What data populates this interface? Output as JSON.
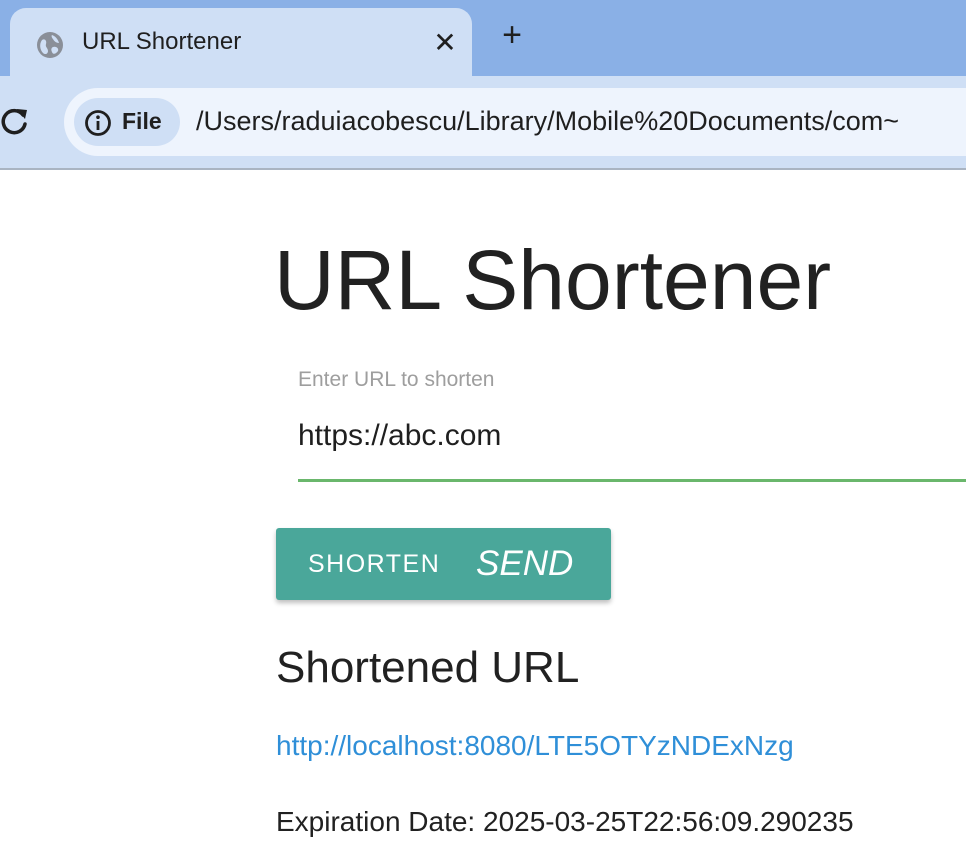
{
  "browser": {
    "tab_title": "URL Shortener",
    "tab_close_glyph": "✕",
    "new_tab_glyph": "+",
    "file_chip_label": "File",
    "address_url": "/Users/raduiacobescu/Library/Mobile%20Documents/com~",
    "icons": {
      "favicon": "globe-icon",
      "reload": "reload-icon",
      "info": "info-icon"
    }
  },
  "page": {
    "title": "URL Shortener",
    "input_label": "Enter URL to shorten",
    "input_value": "https://abc.com",
    "shorten_button_label": "SHORTEN",
    "shorten_button_icon_text": "SEND",
    "result_heading": "Shortened URL",
    "short_url": "http://localhost:8080/LTE5OTYzNDExNzg",
    "expiration_text": "Expiration Date: 2025-03-25T22:56:09.290235"
  },
  "colors": {
    "chrome_background": "#8ab0e6",
    "toolbar_background": "#cfdff5",
    "button_teal": "#4aa79a",
    "input_underline_green": "#6ab76c",
    "link_blue": "#2f8fd8"
  }
}
